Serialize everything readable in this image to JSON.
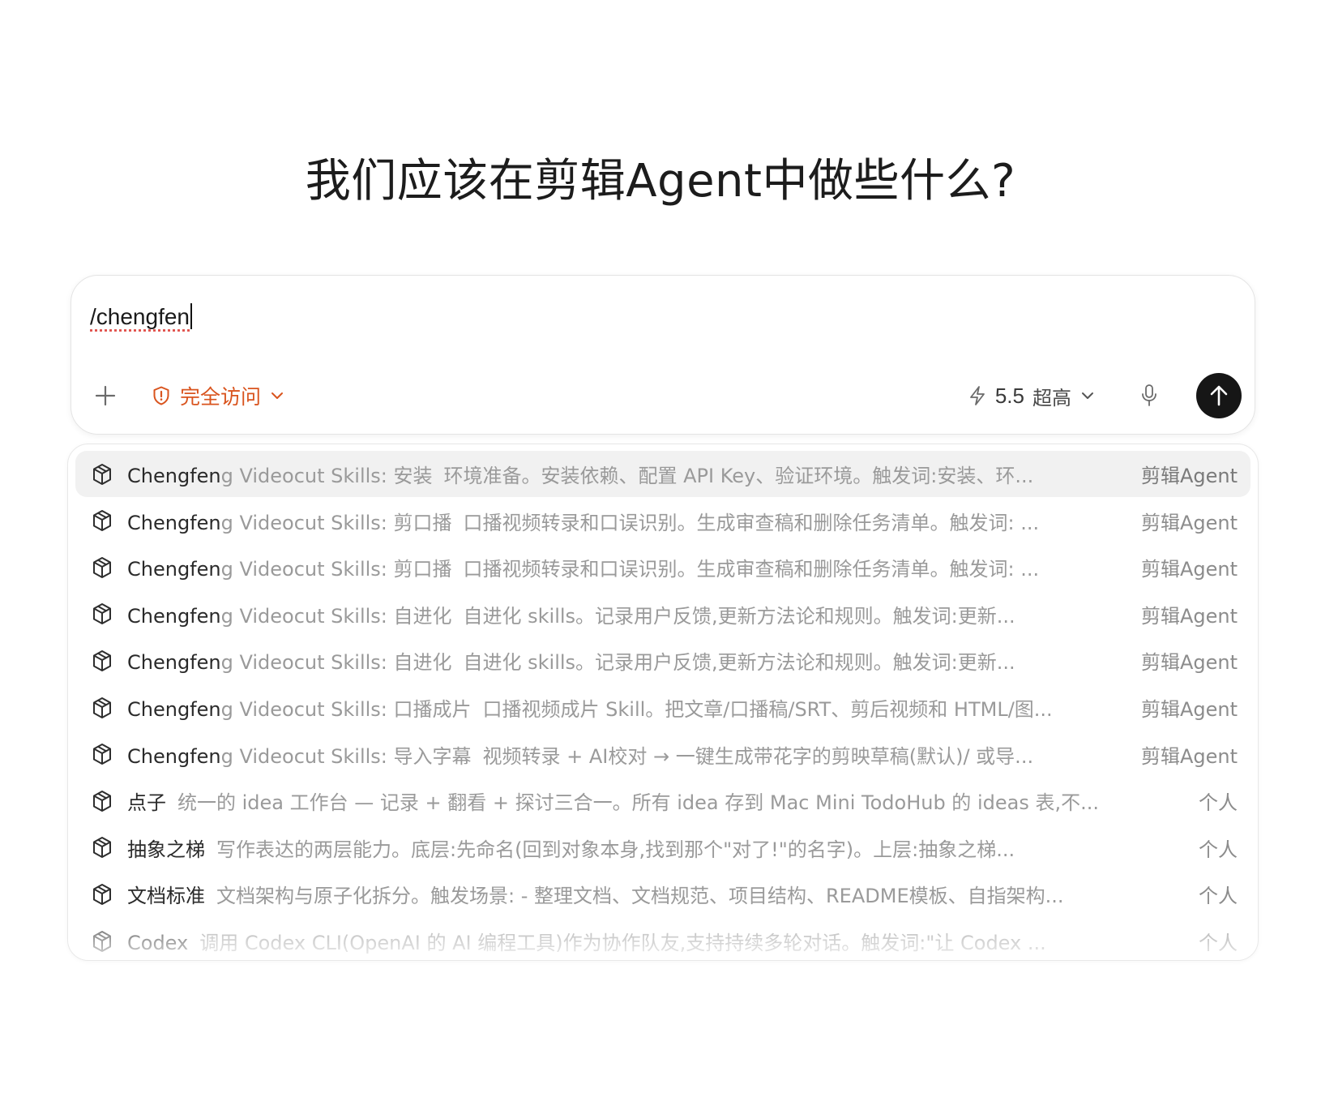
{
  "heading": "我们应该在剪辑Agent中做些什么?",
  "composer": {
    "input_value": "/chengfen",
    "access_label": "完全访问",
    "model_version": "5.5",
    "model_level": "超高"
  },
  "icons": {
    "plus": "plus-icon",
    "shield": "shield-alert-icon",
    "chevron": "chevron-down-icon",
    "bolt": "lightning-icon",
    "mic": "microphone-icon",
    "send": "arrow-up-icon",
    "skill": "cube-icon"
  },
  "colors": {
    "accent": "#d9541e",
    "send_bg": "#161616",
    "selected_row": "#f1f1f1"
  },
  "suggestions": [
    {
      "name_match": "Chengfen",
      "name_rest": "g Videocut Skills: 安装",
      "desc": "环境准备。安装依赖、配置 API Key、验证环境。触发词:安装、环...",
      "scope": "剪辑Agent",
      "selected": true
    },
    {
      "name_match": "Chengfen",
      "name_rest": "g Videocut Skills: 剪口播",
      "desc": "口播视频转录和口误识别。生成审查稿和删除任务清单。触发词: ...",
      "scope": "剪辑Agent"
    },
    {
      "name_match": "Chengfen",
      "name_rest": "g Videocut Skills: 剪口播",
      "desc": "口播视频转录和口误识别。生成审查稿和删除任务清单。触发词: ...",
      "scope": "剪辑Agent"
    },
    {
      "name_match": "Chengfen",
      "name_rest": "g Videocut Skills: 自进化",
      "desc": "自进化 skills。记录用户反馈,更新方法论和规则。触发词:更新...",
      "scope": "剪辑Agent"
    },
    {
      "name_match": "Chengfen",
      "name_rest": "g Videocut Skills: 自进化",
      "desc": "自进化 skills。记录用户反馈,更新方法论和规则。触发词:更新...",
      "scope": "剪辑Agent"
    },
    {
      "name_match": "Chengfen",
      "name_rest": "g Videocut Skills: 口播成片",
      "desc": "口播视频成片 Skill。把文章/口播稿/SRT、剪后视频和 HTML/图...",
      "scope": "剪辑Agent"
    },
    {
      "name_match": "Chengfen",
      "name_rest": "g Videocut Skills: 导入字幕",
      "desc": "视频转录 + AI校对 → 一键生成带花字的剪映草稿(默认)/ 或导...",
      "scope": "剪辑Agent"
    },
    {
      "name_match": "点子",
      "name_rest": "",
      "desc": "统一的 idea 工作台 — 记录 + 翻看 + 探讨三合一。所有 idea 存到 Mac Mini TodoHub 的 ideas 表,不...",
      "scope": "个人"
    },
    {
      "name_match": "抽象之梯",
      "name_rest": "",
      "desc": "写作表达的两层能力。底层:先命名(回到对象本身,找到那个\"对了!\"的名字)。上层:抽象之梯...",
      "scope": "个人"
    },
    {
      "name_match": "文档标准",
      "name_rest": "",
      "desc": "文档架构与原子化拆分。触发场景: - 整理文档、文档规范、项目结构、README模板、自指架构...",
      "scope": "个人"
    },
    {
      "name_match": "Codex",
      "name_rest": "",
      "desc": "调用 Codex CLI(OpenAI 的 AI 编程工具)作为协作队友,支持持续多轮对话。触发词:\"让 Codex ...",
      "scope": "个人"
    }
  ]
}
